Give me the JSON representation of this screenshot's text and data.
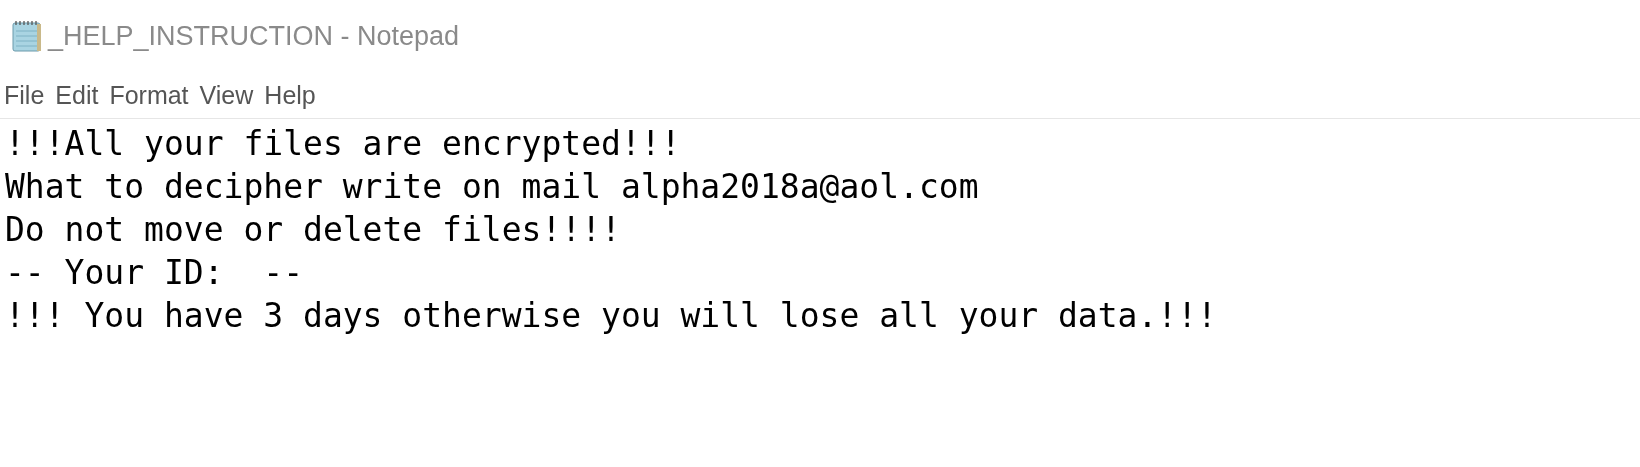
{
  "window": {
    "title": "_HELP_INSTRUCTION - Notepad"
  },
  "menu": [
    "File",
    "Edit",
    "Format",
    "View",
    "Help"
  ],
  "document": {
    "lines": [
      "!!!All your files are encrypted!!!",
      "What to decipher write on mail alpha2018a@aol.com",
      "Do not move or delete files!!!!",
      "-- Your ID:  --",
      "!!! You have 3 days otherwise you will lose all your data.!!!"
    ]
  }
}
